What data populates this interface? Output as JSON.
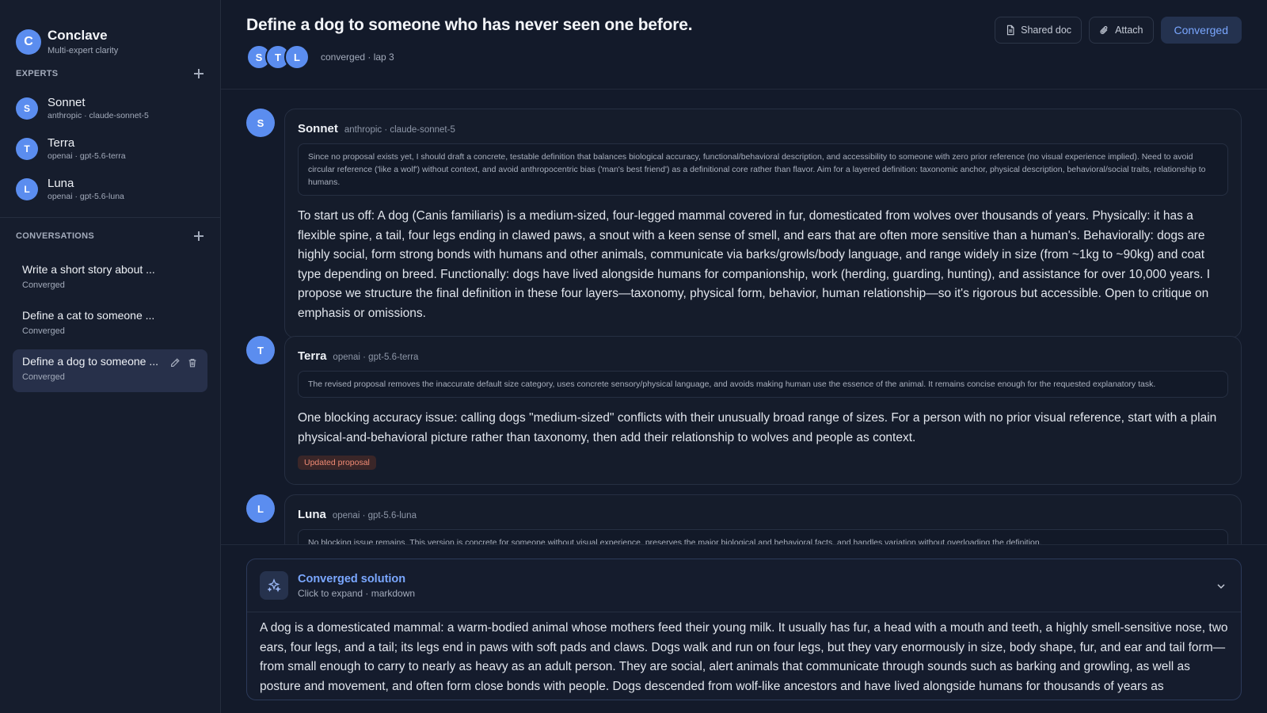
{
  "brand": {
    "logo_letter": "C",
    "name": "Conclave",
    "subtitle": "Multi-expert clarity"
  },
  "sidebar": {
    "experts_label": "EXPERTS",
    "experts": [
      {
        "initial": "S",
        "name": "Sonnet",
        "meta": "anthropic · claude-sonnet-5"
      },
      {
        "initial": "T",
        "name": "Terra",
        "meta": "openai · gpt-5.6-terra"
      },
      {
        "initial": "L",
        "name": "Luna",
        "meta": "openai · gpt-5.6-luna"
      }
    ],
    "conversations_label": "CONVERSATIONS",
    "conversations": [
      {
        "title": "Write a short story about ...",
        "status": "Converged"
      },
      {
        "title": "Define a cat to someone ...",
        "status": "Converged"
      },
      {
        "title": "Define a dog to someone ...",
        "status": "Converged",
        "active": true
      }
    ]
  },
  "header": {
    "title": "Define a dog to someone who has never seen one before.",
    "participants": [
      "S",
      "T",
      "L"
    ],
    "status": "converged · lap 3",
    "buttons": {
      "shared_doc": "Shared doc",
      "attach": "Attach",
      "converged": "Converged"
    }
  },
  "messages": [
    {
      "initial": "S",
      "name": "Sonnet",
      "model": "anthropic · claude-sonnet-5",
      "reasoning": "Since no proposal exists yet, I should draft a concrete, testable definition that balances biological accuracy, functional/behavioral description, and accessibility to someone with zero prior reference (no visual experience implied). Need to avoid circular reference ('like a wolf') without context, and avoid anthropocentric bias ('man's best friend') as a definitional core rather than flavor. Aim for a layered definition: taxonomic anchor, physical description, behavioral/social traits, relationship to humans.",
      "body": "To start us off: A dog (Canis familiaris) is a medium-sized, four-legged mammal covered in fur, domesticated from wolves over thousands of years. Physically: it has a flexible spine, a tail, four legs ending in clawed paws, a snout with a keen sense of smell, and ears that are often more sensitive than a human's. Behaviorally: dogs are highly social, form strong bonds with humans and other animals, communicate via barks/growls/body language, and range widely in size (from ~1kg to ~90kg) and coat type depending on breed. Functionally: dogs have lived alongside humans for companionship, work (herding, guarding, hunting), and assistance for over 10,000 years. I propose we structure the final definition in these four layers—taxonomy, physical form, behavior, human relationship—so it's rigorous but accessible. Open to critique on emphasis or omissions."
    },
    {
      "initial": "T",
      "name": "Terra",
      "model": "openai · gpt-5.6-terra",
      "reasoning": "The revised proposal removes the inaccurate default size category, uses concrete sensory/physical language, and avoids making human use the essence of the animal. It remains concise enough for the requested explanatory task.",
      "body": "One blocking accuracy issue: calling dogs \"medium-sized\" conflicts with their unusually broad range of sizes. For a person with no prior visual reference, start with a plain physical-and-behavioral picture rather than taxonomy, then add their relationship to wolves and people as context.",
      "tag": "Updated proposal"
    },
    {
      "initial": "L",
      "name": "Luna",
      "model": "openai · gpt-5.6-luna",
      "reasoning": "No blocking issue remains. This version is concrete for someone without visual experience, preserves the major biological and behavioral facts, and handles variation without overloading the definition."
    }
  ],
  "solution": {
    "title": "Converged solution",
    "subtitle": "Click to expand · markdown",
    "body": "A dog is a domesticated mammal: a warm-bodied animal whose mothers feed their young milk. It usually has fur, a head with a mouth and teeth, a highly smell-sensitive nose, two ears, four legs, and a tail; its legs end in paws with soft pads and claws. Dogs walk and run on four legs, but they vary enormously in size, body shape, fur, and ear and tail form—from small enough to carry to nearly as heavy as an adult person. They are social, alert animals that communicate through sounds such as barking and growling, as well as posture and movement, and often form close bonds with people. Dogs descended from wolf-like ancestors and have lived alongside humans for thousands of years as companions and for work."
  },
  "colors": {
    "accent": "#5b8def",
    "accent_text": "#7aa7ff",
    "background": "#131a2a",
    "tag": "#f08a74"
  }
}
